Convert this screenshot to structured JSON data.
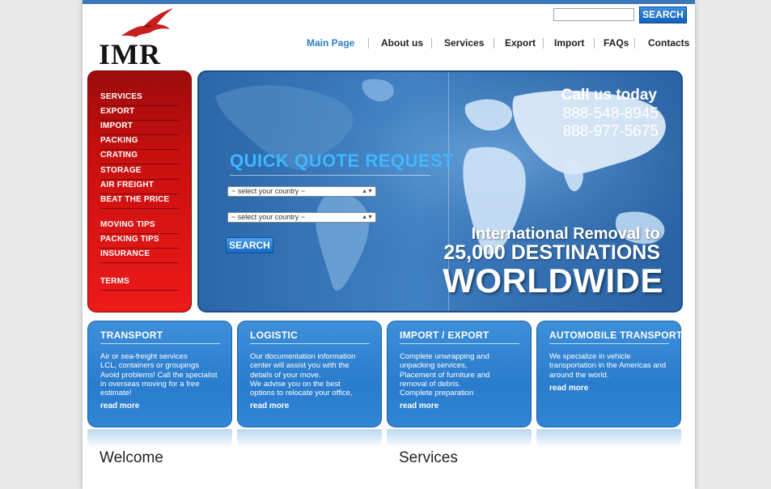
{
  "header": {
    "logo_text": "IMR",
    "search_placeholder": "",
    "search_button": "SEARCH"
  },
  "nav": [
    {
      "label": "Main Page"
    },
    {
      "label": "About us"
    },
    {
      "label": "Services"
    },
    {
      "label": "Export"
    },
    {
      "label": "Import"
    },
    {
      "label": "FAQs"
    },
    {
      "label": "Contacts"
    }
  ],
  "sidebar": {
    "items": [
      {
        "label": "SERVICES"
      },
      {
        "label": "EXPORT"
      },
      {
        "label": "IMPORT"
      },
      {
        "label": "PACKING"
      },
      {
        "label": "CRATING"
      },
      {
        "label": "STORAGE"
      },
      {
        "label": "AIR FREIGHT"
      },
      {
        "label": "BEAT THE PRICE"
      },
      {
        "label": "MOVING TIPS"
      },
      {
        "label": "PACKING TIPS"
      },
      {
        "label": "INSURANCE"
      },
      {
        "label": "TERMS"
      }
    ]
  },
  "banner": {
    "quote_title": "QUICK QUOTE REQUEST",
    "select_from": "~ select your country ~",
    "select_to": "~ select your country ~",
    "quote_button": "SEARCH",
    "call_title": "Call us today",
    "phone1": "888-548-8945",
    "phone2": "888-977-5675",
    "headline1": "International Removal to",
    "headline2": "25,000 DESTINATIONS",
    "headline3": "WORLDWIDE"
  },
  "boxes": [
    {
      "title": "TRANSPORT",
      "lines": [
        "Air or sea-freight services",
        "LCL, containers or groupings",
        "Avoid problems! Call the specialist",
        "in overseas moving for a free",
        "estimate!"
      ],
      "more": "read more"
    },
    {
      "title": "LOGISTIC",
      "lines": [
        "Our documentation information",
        "center will assist you with the",
        "details of your move.",
        "We advise you on the best",
        "options to relocate your office,"
      ],
      "more": "read more"
    },
    {
      "title": "IMPORT / EXPORT",
      "lines": [
        "Complete unwrapping and",
        "unpacking services,",
        "Placement of furniture and",
        "removal of debris.",
        "Complete preparation"
      ],
      "more": "read more"
    },
    {
      "title": "AUTOMOBILE TRANSPORT",
      "lines": [
        "We specialize in vehicle",
        "transportation in the Americas and",
        "around the world."
      ],
      "more": "read more"
    }
  ],
  "sections": {
    "welcome": "Welcome",
    "services": "Services"
  },
  "colors": {
    "accent_blue": "#2d7fc8",
    "menu_red": "#c80f0f",
    "box_blue": "#2a7ccd"
  }
}
